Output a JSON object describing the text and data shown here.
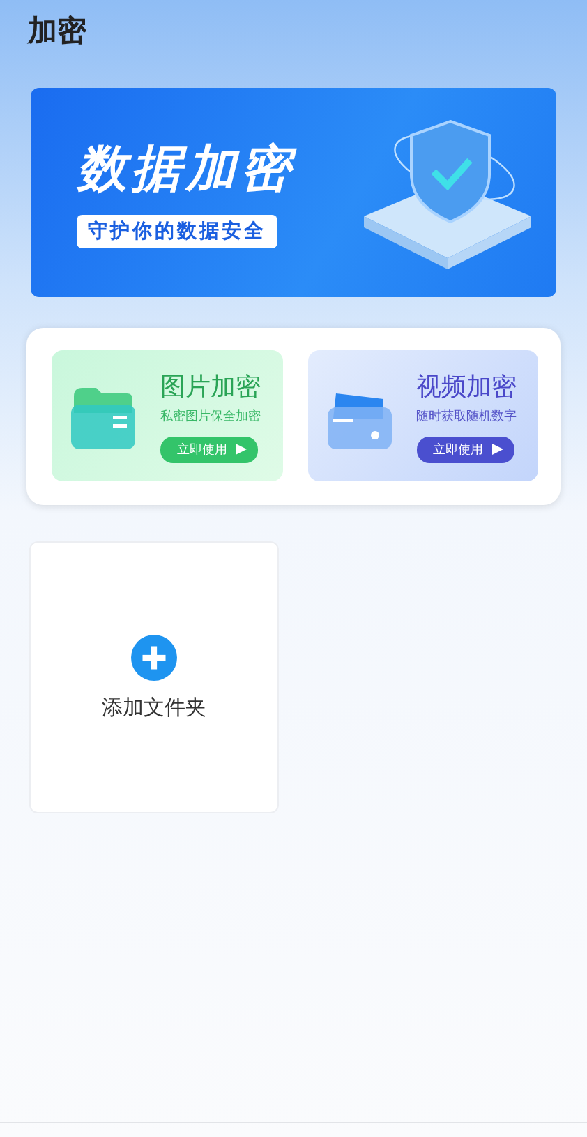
{
  "header": {
    "title": "加密"
  },
  "banner": {
    "title": "数据加密",
    "subtitle": "守护你的数据安全"
  },
  "features": [
    {
      "kind": "photo",
      "title": "图片加密",
      "subtitle": "私密图片保全加密",
      "button": "立即使用"
    },
    {
      "kind": "video",
      "title": "视频加密",
      "subtitle": "随时获取随机数字",
      "button": "立即使用"
    }
  ],
  "folders": [
    {
      "label": "添加文件夹"
    }
  ]
}
